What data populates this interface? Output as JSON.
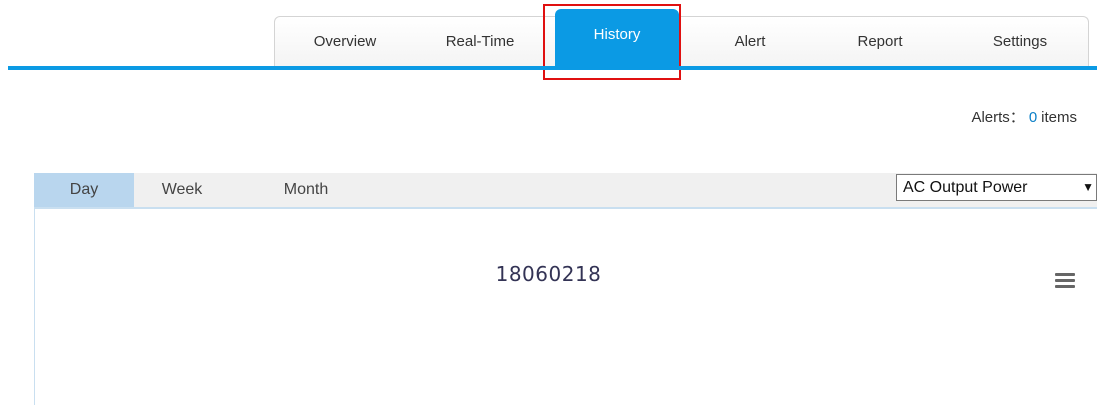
{
  "nav": {
    "tabs": [
      {
        "label": "Overview"
      },
      {
        "label": "Real-Time"
      },
      {
        "label": "History"
      },
      {
        "label": "Alert"
      },
      {
        "label": "Report"
      },
      {
        "label": "Settings"
      }
    ],
    "active": "History"
  },
  "alerts": {
    "label": "Alerts：",
    "count": "0",
    "unit": "items"
  },
  "sub_tabs": {
    "tabs": [
      {
        "label": "Day"
      },
      {
        "label": "Week"
      },
      {
        "label": "Month"
      }
    ],
    "active": "Day"
  },
  "metric_select": {
    "value": "AC Output Power"
  },
  "chart": {
    "title": "18060218"
  },
  "colors": {
    "accent": "#0b9ae4",
    "highlight": "#e01010",
    "sub_tab_active": "#b9d6ee"
  },
  "icons": {
    "menu": "hamburger-menu-icon",
    "dropdown": "chevron-down-icon"
  }
}
